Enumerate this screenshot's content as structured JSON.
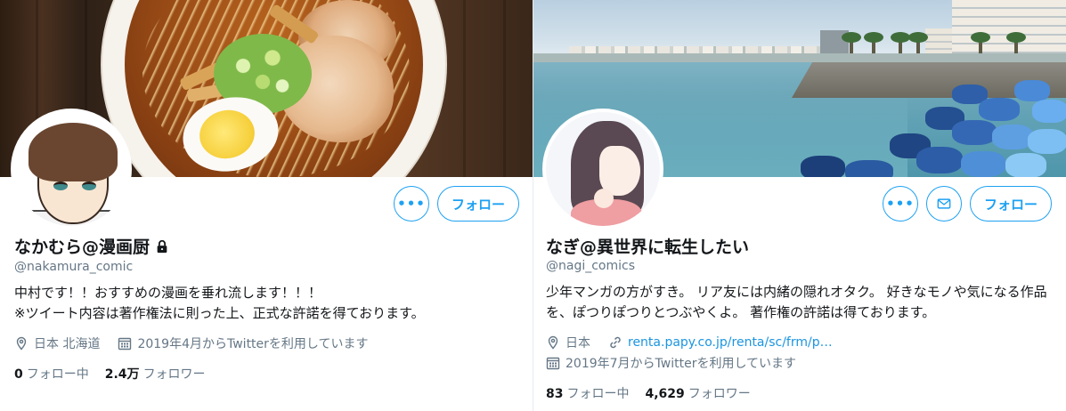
{
  "profiles": [
    {
      "display_name": "なかむら@漫画厨",
      "handle": "@nakamura_comic",
      "bio_lines": [
        "中村です！！おすすめの漫画を垂れ流します！！！",
        "※ツイート内容は著作権法に則った上、正式な許諾を得ております。"
      ],
      "location": "日本 北海道",
      "joined": "2019年4月からTwitterを利用しています",
      "following_count": "0",
      "following_label": "フォロー中",
      "followers_count": "2.4万",
      "followers_label": "フォロワー",
      "more_label": "•••",
      "follow_label": "フォロー",
      "locked": true
    },
    {
      "display_name": "なぎ@異世界に転生したい",
      "handle": "@nagi_comics",
      "bio_lines": [
        "少年マンガの方がすき。 リア友には内緒の隠れオタク。 好きなモノや気になる作品",
        "を、ぽつりぽつりとつぶやくよ。 著作権の許諾は得ております。"
      ],
      "location": "日本",
      "website": "renta.papy.co.jp/renta/sc/frm/p…",
      "joined": "2019年7月からTwitterを利用しています",
      "following_count": "83",
      "following_label": "フォロー中",
      "followers_count": "4,629",
      "followers_label": "フォロワー",
      "more_label": "•••",
      "follow_label": "フォロー"
    }
  ],
  "icons": {
    "location": "location-pin-icon",
    "calendar": "calendar-icon",
    "link": "link-icon",
    "lock": "lock-icon",
    "mail": "mail-icon"
  },
  "colors": {
    "accent": "#1da1f2",
    "secondary_text": "#657786",
    "link": "#1b95e0"
  }
}
